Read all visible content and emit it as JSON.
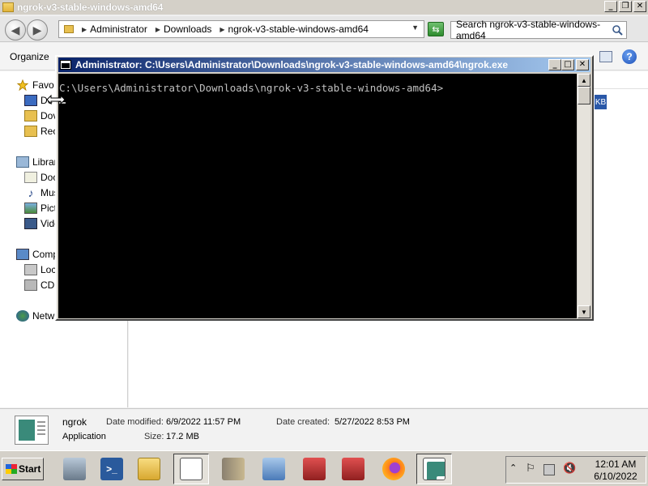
{
  "explorer": {
    "title": "ngrok-v3-stable-windows-amd64",
    "address": {
      "crumbs": [
        "Administrator",
        "Downloads",
        "ngrok-v3-stable-windows-amd64"
      ]
    },
    "search_placeholder": "Search ngrok-v3-stable-windows-amd64",
    "toolbar": {
      "organize_label": "Organize"
    },
    "nav_items": [
      {
        "label": "Favo",
        "icon": "star-icon"
      },
      {
        "label": "De",
        "icon": "desktop-icon"
      },
      {
        "label": "Dov",
        "icon": "downloads-icon"
      },
      {
        "label": "Rec",
        "icon": "recent-places-icon"
      },
      {
        "label": "Librar",
        "icon": "libraries-icon"
      },
      {
        "label": "Doc",
        "icon": "documents-icon"
      },
      {
        "label": "Mus",
        "icon": "music-icon"
      },
      {
        "label": "Pict",
        "icon": "pictures-icon"
      },
      {
        "label": "Vide",
        "icon": "videos-icon"
      },
      {
        "label": "Comp",
        "icon": "computer-icon"
      },
      {
        "label": "Loc",
        "icon": "local-disk-icon"
      },
      {
        "label": "CD",
        "icon": "cd-drive-icon"
      },
      {
        "label": "Netw",
        "icon": "network-icon"
      }
    ],
    "content_fragment": "KB",
    "details": {
      "name": "ngrok",
      "type": "Application",
      "modified_label": "Date modified:",
      "modified_value": "6/9/2022 11:57 PM",
      "size_label": "Size:",
      "size_value": "17.2 MB",
      "created_label": "Date created:",
      "created_value": "5/27/2022 8:53 PM"
    }
  },
  "console": {
    "title": "Administrator: C:\\Users\\Administrator\\Downloads\\ngrok-v3-stable-windows-amd64\\ngrok.exe",
    "prompt": "C:\\Users\\Administrator\\Downloads\\ngrok-v3-stable-windows-amd64>"
  },
  "taskbar": {
    "start_label": "Start",
    "items": [
      {
        "name": "server-manager-icon",
        "color": "#8a9aa8"
      },
      {
        "name": "powershell-icon",
        "color": "#2a5a9c"
      },
      {
        "name": "explorer-folder-icon",
        "color": "#e8c050"
      },
      {
        "name": "notepad-icon",
        "color": "#ffffff"
      },
      {
        "name": "tools-icon",
        "color": "#8a8070"
      },
      {
        "name": "control-panel-icon",
        "color": "#6a9ad0"
      },
      {
        "name": "toolbox-icon",
        "color": "#c03030"
      },
      {
        "name": "toolbox-icon-2",
        "color": "#c03030"
      },
      {
        "name": "firefox-icon",
        "color": "#ff7a1a"
      },
      {
        "name": "console-window-icon",
        "color": "#3a8a7a"
      }
    ],
    "clock_time": "12:01 AM",
    "clock_date": "6/10/2022"
  }
}
